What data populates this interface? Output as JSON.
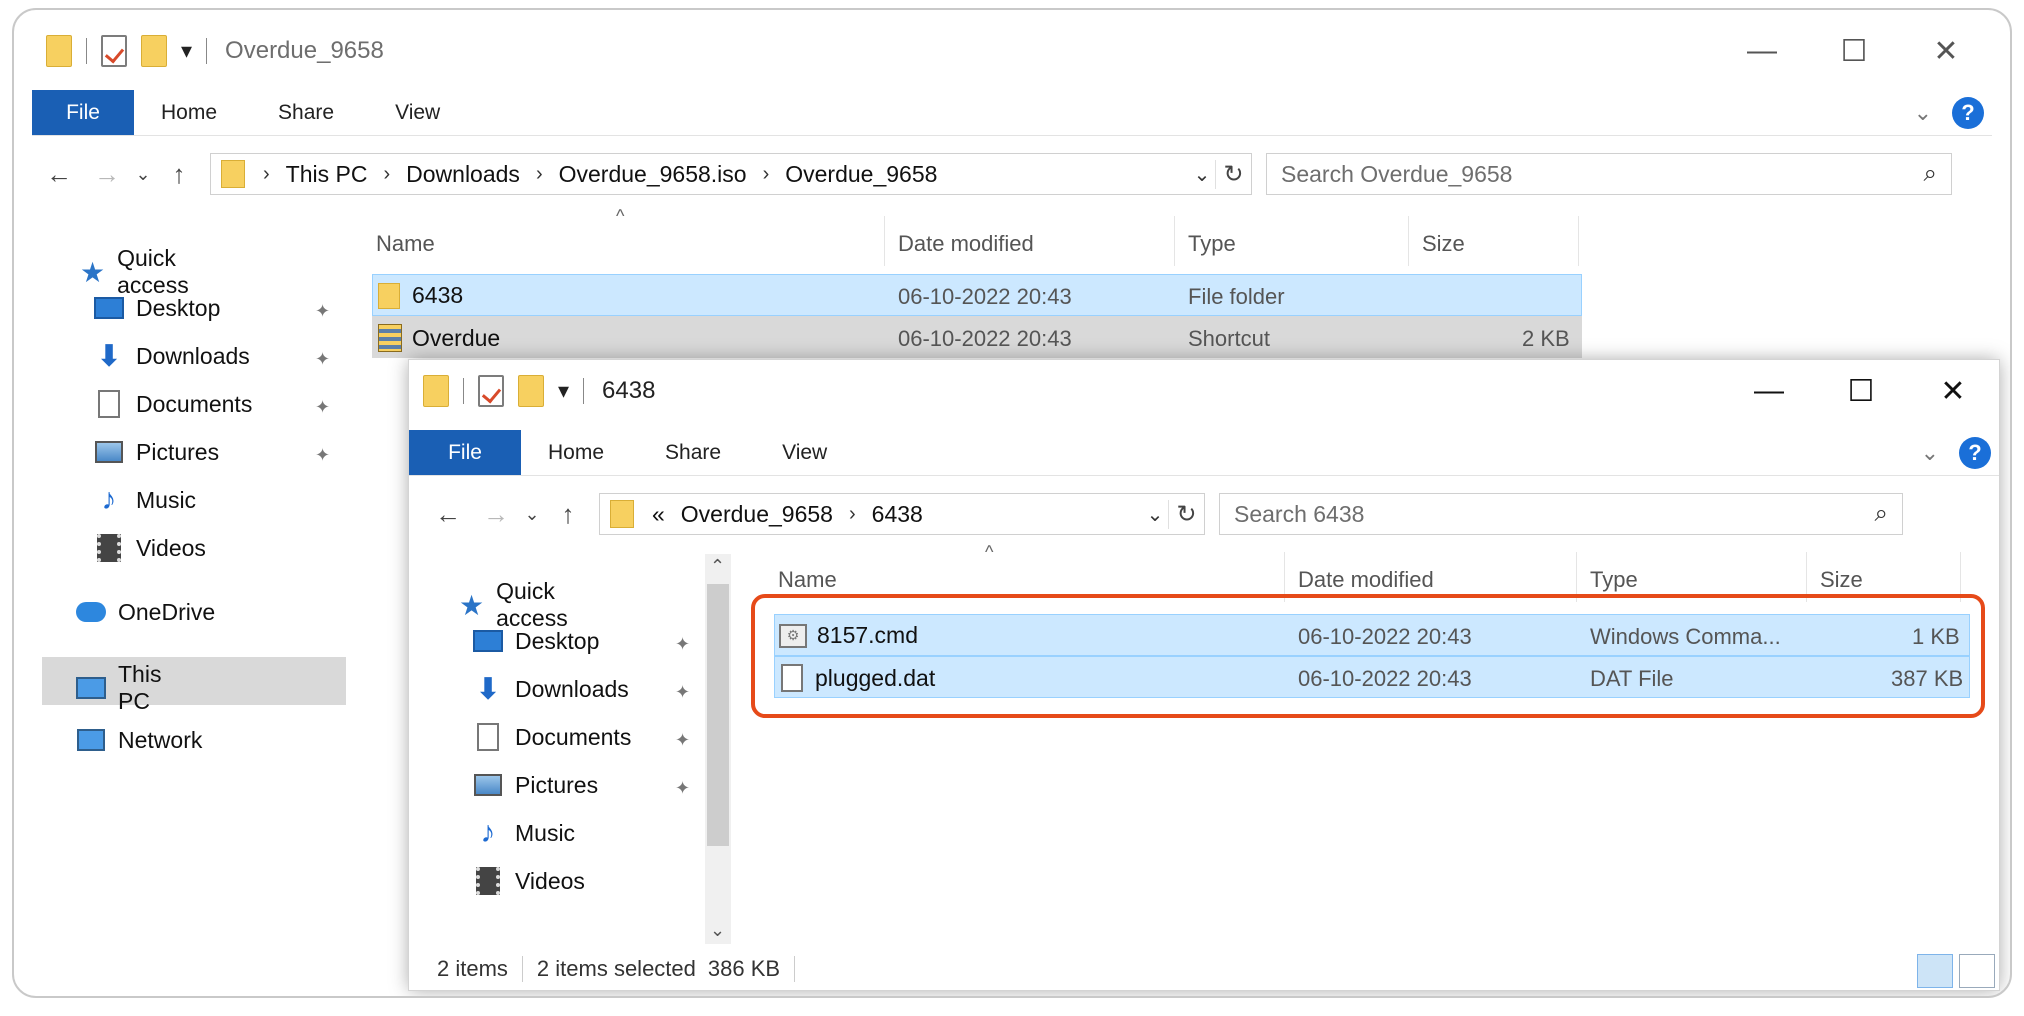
{
  "window1": {
    "title": "Overdue_9658",
    "ribbon": {
      "file": "File",
      "home": "Home",
      "share": "Share",
      "view": "View"
    },
    "breadcrumb": [
      "This PC",
      "Downloads",
      "Overdue_9658.iso",
      "Overdue_9658"
    ],
    "search_placeholder": "Search Overdue_9658",
    "columns": {
      "name": "Name",
      "date": "Date modified",
      "type": "Type",
      "size": "Size"
    },
    "files": [
      {
        "name": "6438",
        "date": "06-10-2022 20:43",
        "type": "File folder",
        "size": ""
      },
      {
        "name": "Overdue",
        "date": "06-10-2022 20:43",
        "type": "Shortcut",
        "size": "2 KB"
      }
    ],
    "sidebar": {
      "quick_access": "Quick access",
      "items": [
        "Desktop",
        "Downloads",
        "Documents",
        "Pictures",
        "Music",
        "Videos"
      ],
      "onedrive": "OneDrive",
      "this_pc": "This PC",
      "network": "Network"
    }
  },
  "window2": {
    "title": "6438",
    "ribbon": {
      "file": "File",
      "home": "Home",
      "share": "Share",
      "view": "View"
    },
    "breadcrumb_prefix": "«",
    "breadcrumb": [
      "Overdue_9658",
      "6438"
    ],
    "search_placeholder": "Search 6438",
    "columns": {
      "name": "Name",
      "date": "Date modified",
      "type": "Type",
      "size": "Size"
    },
    "files": [
      {
        "name": "8157.cmd",
        "date": "06-10-2022 20:43",
        "type": "Windows Comma...",
        "size": "1 KB"
      },
      {
        "name": "plugged.dat",
        "date": "06-10-2022 20:43",
        "type": "DAT File",
        "size": "387 KB"
      }
    ],
    "sidebar": {
      "quick_access": "Quick access",
      "items": [
        "Desktop",
        "Downloads",
        "Documents",
        "Pictures",
        "Music",
        "Videos"
      ]
    },
    "status": {
      "count": "2 items",
      "selected": "2 items selected",
      "size": "386 KB"
    }
  },
  "icons": {
    "minimize": "—",
    "maximize": "☐",
    "close": "✕",
    "back": "←",
    "forward": "→",
    "recent": "⌄",
    "up": "↑",
    "refresh": "↻",
    "search": "⚲",
    "pin": "📌",
    "help": "?"
  },
  "colors": {
    "file_tab": "#1a5fb4",
    "selection": "#cce8ff",
    "highlight": "#e64a19"
  }
}
